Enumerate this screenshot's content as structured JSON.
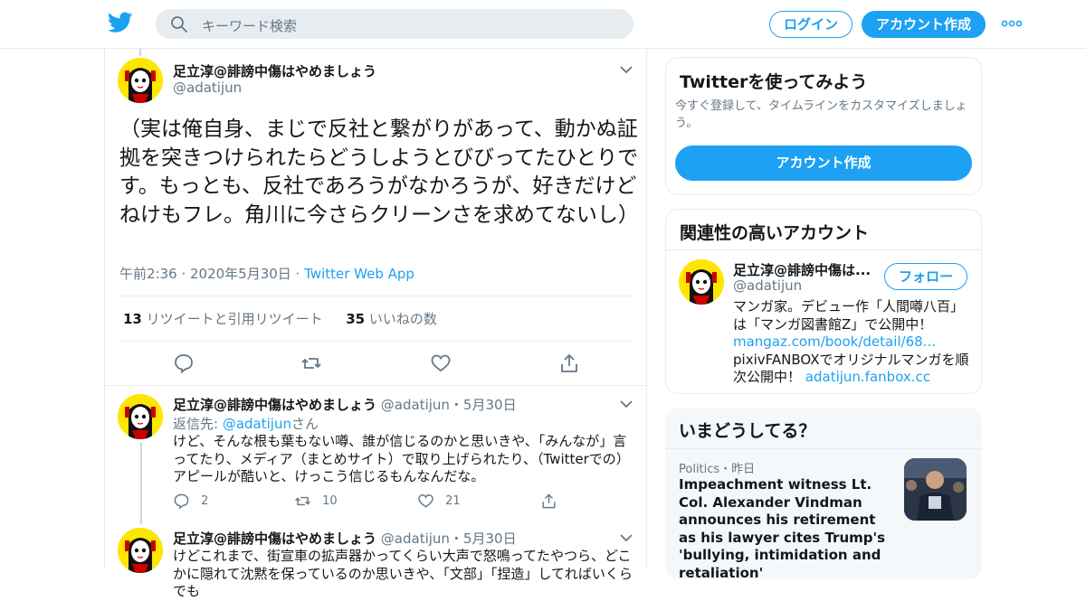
{
  "header": {
    "search_placeholder": "キーワード検索",
    "login_label": "ログイン",
    "signup_label": "アカウント作成"
  },
  "tweet": {
    "author_name": "足立淳@誹謗中傷はやめましょう",
    "author_handle": "@adatijun",
    "text": "（実は俺自身、まじで反社と繋がりがあって、動かぬ証拠を突きつけられたらどうしようとびびってたひとりです。もっとも、反社であろうがなかろうが、好きだけどねけもフレ。角川に今さらクリーンさを求めてないし）",
    "time": "午前2:36",
    "date": "2020年5月30日",
    "source": "Twitter Web App",
    "retweets_count": "13",
    "retweets_label": "リツイートと引用リツイート",
    "likes_count": "35",
    "likes_label": "いいねの数"
  },
  "replies": [
    {
      "author_name": "足立淳@誹謗中傷はやめましょう",
      "handle_date": "@adatijun・5月30日",
      "reply_to_prefix": "返信先: ",
      "reply_to_handle": "@adatijun",
      "reply_to_suffix": "さん",
      "text": "けど、そんな根も葉もない噂、誰が信じるのかと思いきや、「みんなが」言ってたり、メディア（まとめサイト）で取り上げられたり、（Twitterでの）アピールが酷いと、けっこう信じるもんなんだな。",
      "replies": "2",
      "retweets": "10",
      "likes": "21"
    },
    {
      "author_name": "足立淳@誹謗中傷はやめましょう",
      "handle_date": "@adatijun・5月30日",
      "text": "けどこれまで、街宣車の拡声器かってくらい大声で怒鳴ってたやつら、どこかに隠れて沈黙を保っているのか思いきや、「文部」「捏造」してればいくらでも"
    }
  ],
  "sidebar": {
    "try_title": "Twitterを使ってみよう",
    "try_desc": "今すぐ登録して、タイムラインをカスタマイズしましょう。",
    "try_button": "アカウント作成",
    "related_title": "関連性の高いアカウント",
    "related_name": "足立淳@誹謗中傷は...",
    "related_handle": "@adatijun",
    "follow_label": "フォロー",
    "bio_line1": "マンガ家。デビュー作「人間噂八百」",
    "bio_line2": "は「マンガ図書館Z」で公開中！",
    "bio_link1": "mangaz.com/book/detail/68...",
    "bio_line3": "pixivFANBOXでオリジナルマンガを順",
    "bio_line4": "次公開中！",
    "bio_link2": "adatijun.fanbox.cc",
    "trends_title": "いまどうしてる？",
    "trend_category": "Politics・昨日",
    "trend_headline": "Impeachment witness Lt. Col. Alexander Vindman announces his retirement as his lawyer cites Trump's 'bullying, intimidation and retaliation'"
  },
  "colors": {
    "accent": "#1da1f2",
    "muted": "#657786",
    "border": "#e6ecf0"
  }
}
